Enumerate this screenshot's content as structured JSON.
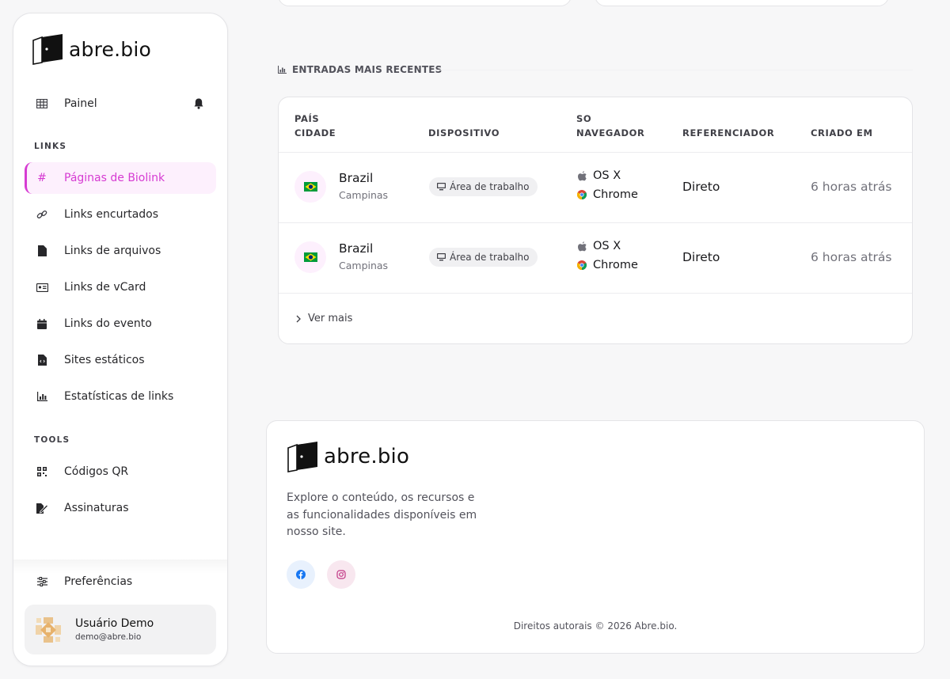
{
  "brand": {
    "name": "abre.bio",
    "accent": "#d63bd2"
  },
  "sidebar": {
    "dashboard": "Painel",
    "links_section": "LINKS",
    "items": [
      {
        "label": "Páginas de Biolink",
        "icon": "hash-icon",
        "active": true
      },
      {
        "label": "Links encurtados",
        "icon": "link-icon"
      },
      {
        "label": "Links de arquivos",
        "icon": "file-icon"
      },
      {
        "label": "Links de vCard",
        "icon": "id-card-icon"
      },
      {
        "label": "Links do evento",
        "icon": "calendar-icon"
      },
      {
        "label": "Sites estáticos",
        "icon": "file-code-icon"
      },
      {
        "label": "Estatísticas de links",
        "icon": "bar-chart-icon"
      }
    ],
    "tools_section": "TOOLS",
    "tools": [
      {
        "label": "Códigos QR",
        "icon": "qrcode-icon"
      },
      {
        "label": "Assinaturas",
        "icon": "signature-icon"
      }
    ],
    "preferences": "Preferências",
    "user": {
      "name": "Usuário Demo",
      "email": "demo@abre.bio"
    }
  },
  "recent": {
    "title": "ENTRADAS MAIS RECENTES",
    "headers": {
      "country": "PAÍS",
      "city": "CIDADE",
      "device": "DISPOSITIVO",
      "os": "SO",
      "browser": "NAVEGADOR",
      "referrer": "REFERENCIADOR",
      "created": "CRIADO EM"
    },
    "rows": [
      {
        "country": "Brazil",
        "city": "Campinas",
        "device": "Área de trabalho",
        "os": "OS X",
        "browser": "Chrome",
        "referrer": "Direto",
        "created": "6 horas atrás"
      },
      {
        "country": "Brazil",
        "city": "Campinas",
        "device": "Área de trabalho",
        "os": "OS X",
        "browser": "Chrome",
        "referrer": "Direto",
        "created": "6 horas atrás"
      }
    ],
    "more": "Ver mais"
  },
  "footer": {
    "description": "Explore o conteúdo, os recursos e as funcionalidades disponíveis em nosso site.",
    "social": [
      {
        "icon": "facebook-icon",
        "color": "#1877f2"
      },
      {
        "icon": "instagram-icon",
        "color": "#c13584"
      }
    ],
    "copyright": "Direitos autorais © 2026 Abre.bio."
  }
}
